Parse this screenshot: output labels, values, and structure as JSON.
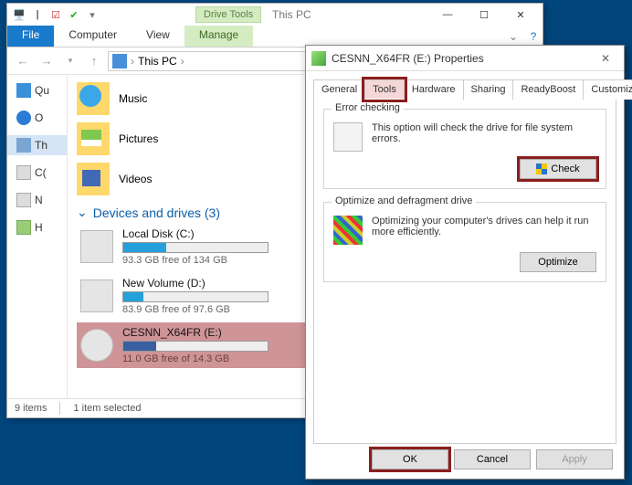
{
  "explorer": {
    "drive_tools_label": "Drive Tools",
    "crumb": "This PC",
    "tabs": {
      "file": "File",
      "computer": "Computer",
      "view": "View",
      "manage": "Manage"
    },
    "address": {
      "location": "This PC"
    },
    "nav": {
      "quick": "Qu",
      "onedrive": "O",
      "thispc": "Th",
      "drive_c": "C(",
      "drive_d": "N",
      "drive_e": "H"
    },
    "folders": {
      "music": "Music",
      "pictures": "Pictures",
      "videos": "Videos"
    },
    "section_header": "Devices and drives (3)",
    "drives": [
      {
        "name": "Local Disk (C:)",
        "free": "93.3 GB free of 134 GB",
        "pct": 30
      },
      {
        "name": "New Volume (D:)",
        "free": "83.9 GB free of 97.6 GB",
        "pct": 14
      },
      {
        "name": "CESNN_X64FR (E:)",
        "free": "11.0 GB free of 14.3 GB",
        "pct": 23
      }
    ],
    "status": {
      "items": "9 items",
      "selected": "1 item selected"
    }
  },
  "props": {
    "title": "CESNN_X64FR (E:) Properties",
    "tabs": {
      "general": "General",
      "tools": "Tools",
      "hardware": "Hardware",
      "sharing": "Sharing",
      "readyboost": "ReadyBoost",
      "customize": "Customize"
    },
    "error_group": {
      "label": "Error checking",
      "text": "This option will check the drive for file system errors.",
      "button": "Check"
    },
    "defrag_group": {
      "label": "Optimize and defragment drive",
      "text": "Optimizing your computer's drives can help it run more efficiently.",
      "button": "Optimize"
    },
    "footer": {
      "ok": "OK",
      "cancel": "Cancel",
      "apply": "Apply"
    }
  }
}
